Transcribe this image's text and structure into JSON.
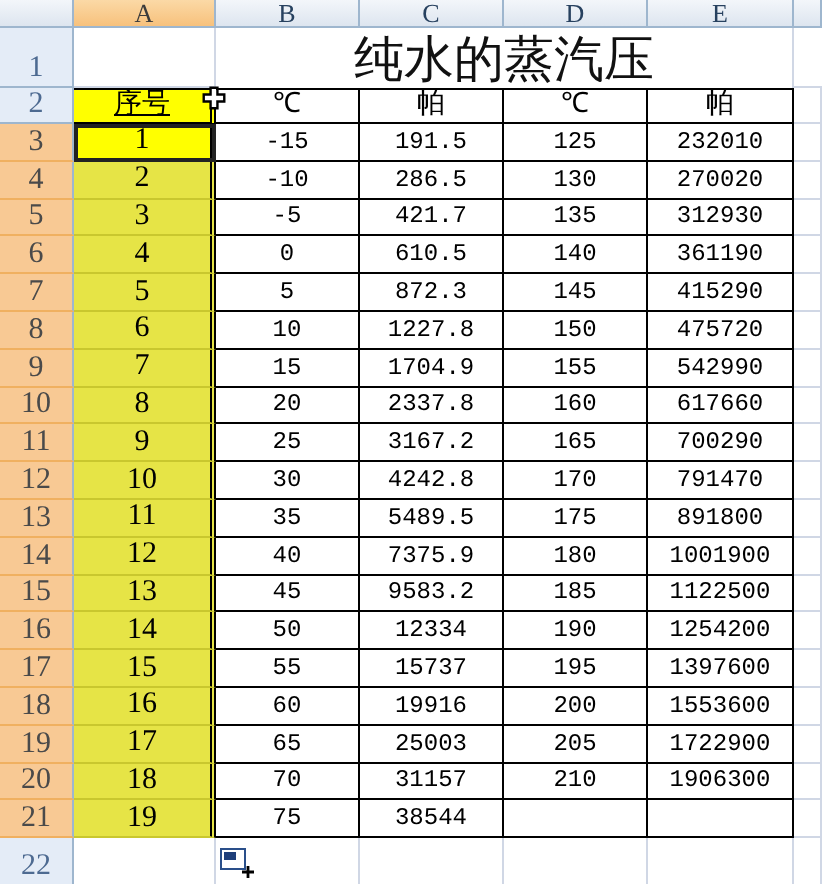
{
  "columns": [
    {
      "label": "A",
      "selected": true
    },
    {
      "label": "B",
      "selected": false
    },
    {
      "label": "C",
      "selected": false
    },
    {
      "label": "D",
      "selected": false
    },
    {
      "label": "E",
      "selected": false
    }
  ],
  "rows": [
    {
      "kind": "title",
      "number": "1",
      "selected": false,
      "title": "纯水的蒸汽压"
    },
    {
      "kind": "header",
      "number": "2",
      "selected": false,
      "cells": [
        "序号",
        "℃",
        "帕",
        "℃",
        "帕"
      ]
    },
    {
      "kind": "data",
      "number": "3",
      "selected": true,
      "active": true,
      "cells": [
        "1",
        "-15",
        "191.5",
        "125",
        "232010"
      ]
    },
    {
      "kind": "data",
      "number": "4",
      "selected": true,
      "active": false,
      "cells": [
        "2",
        "-10",
        "286.5",
        "130",
        "270020"
      ]
    },
    {
      "kind": "data",
      "number": "5",
      "selected": true,
      "active": false,
      "cells": [
        "3",
        "-5",
        "421.7",
        "135",
        "312930"
      ]
    },
    {
      "kind": "data",
      "number": "6",
      "selected": true,
      "active": false,
      "cells": [
        "4",
        "0",
        "610.5",
        "140",
        "361190"
      ]
    },
    {
      "kind": "data",
      "number": "7",
      "selected": true,
      "active": false,
      "cells": [
        "5",
        "5",
        "872.3",
        "145",
        "415290"
      ]
    },
    {
      "kind": "data",
      "number": "8",
      "selected": true,
      "active": false,
      "cells": [
        "6",
        "10",
        "1227.8",
        "150",
        "475720"
      ]
    },
    {
      "kind": "data",
      "number": "9",
      "selected": true,
      "active": false,
      "cells": [
        "7",
        "15",
        "1704.9",
        "155",
        "542990"
      ]
    },
    {
      "kind": "data",
      "number": "10",
      "selected": true,
      "active": false,
      "cells": [
        "8",
        "20",
        "2337.8",
        "160",
        "617660"
      ]
    },
    {
      "kind": "data",
      "number": "11",
      "selected": true,
      "active": false,
      "cells": [
        "9",
        "25",
        "3167.2",
        "165",
        "700290"
      ]
    },
    {
      "kind": "data",
      "number": "12",
      "selected": true,
      "active": false,
      "cells": [
        "10",
        "30",
        "4242.8",
        "170",
        "791470"
      ]
    },
    {
      "kind": "data",
      "number": "13",
      "selected": true,
      "active": false,
      "cells": [
        "11",
        "35",
        "5489.5",
        "175",
        "891800"
      ]
    },
    {
      "kind": "data",
      "number": "14",
      "selected": true,
      "active": false,
      "cells": [
        "12",
        "40",
        "7375.9",
        "180",
        "1001900"
      ]
    },
    {
      "kind": "data",
      "number": "15",
      "selected": true,
      "active": false,
      "cells": [
        "13",
        "45",
        "9583.2",
        "185",
        "1122500"
      ]
    },
    {
      "kind": "data",
      "number": "16",
      "selected": true,
      "active": false,
      "cells": [
        "14",
        "50",
        "12334",
        "190",
        "1254200"
      ]
    },
    {
      "kind": "data",
      "number": "17",
      "selected": true,
      "active": false,
      "cells": [
        "15",
        "55",
        "15737",
        "195",
        "1397600"
      ]
    },
    {
      "kind": "data",
      "number": "18",
      "selected": true,
      "active": false,
      "cells": [
        "16",
        "60",
        "19916",
        "200",
        "1553600"
      ]
    },
    {
      "kind": "data",
      "number": "19",
      "selected": true,
      "active": false,
      "cells": [
        "17",
        "65",
        "25003",
        "205",
        "1722900"
      ]
    },
    {
      "kind": "data",
      "number": "20",
      "selected": true,
      "active": false,
      "cells": [
        "18",
        "70",
        "31157",
        "210",
        "1906300"
      ]
    },
    {
      "kind": "data",
      "number": "21",
      "selected": true,
      "active": false,
      "cells": [
        "19",
        "75",
        "38544",
        "",
        ""
      ]
    },
    {
      "kind": "empty",
      "number": "22",
      "selected": false
    }
  ]
}
